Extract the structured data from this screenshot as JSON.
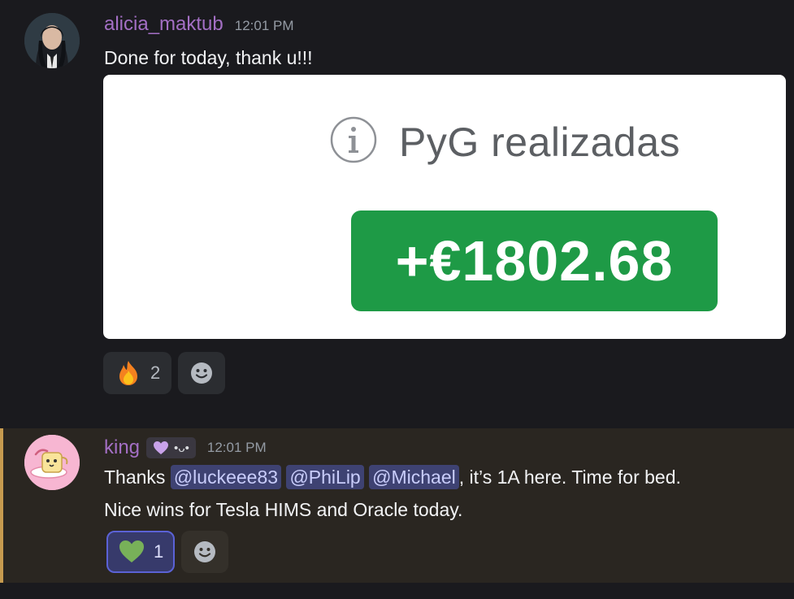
{
  "messages": [
    {
      "username": "alicia_maktub",
      "username_color": "#a36fc4",
      "timestamp": "12:01 PM",
      "text": "Done for today, thank u!!!",
      "embed": {
        "title": "PyG realizadas",
        "value": "+€1802.68",
        "value_bg": "#1e9a46"
      },
      "reactions": [
        {
          "emoji": "fire-emoji",
          "count": "2",
          "active": false
        }
      ]
    },
    {
      "username": "king",
      "username_color": "#a36fc4",
      "badge_text": "•ᴗ•",
      "timestamp": "12:01 PM",
      "highlight_color": "#c69a4f",
      "text_prefix": "Thanks ",
      "mentions": [
        "@luckeee83",
        "@PhiLip",
        "@Michael"
      ],
      "text_suffix": ", it’s 1A here. Time for bed.",
      "text_line2": "Nice wins for Tesla HIMS and Oracle today.",
      "reactions": [
        {
          "emoji": "green-heart-emoji",
          "count": "1",
          "active": true
        }
      ]
    }
  ]
}
